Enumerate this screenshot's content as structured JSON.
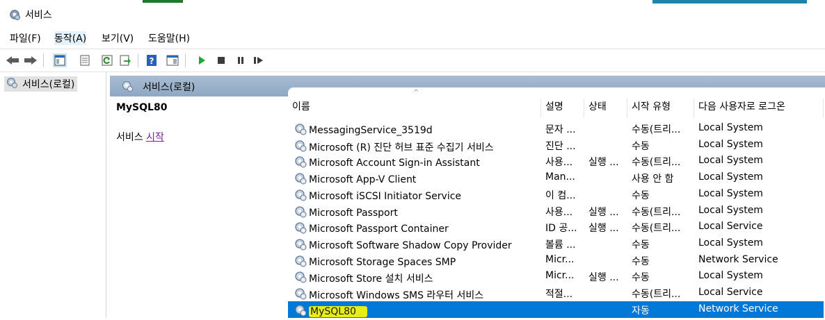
{
  "window": {
    "title": "서비스"
  },
  "menu": [
    "파일(F)",
    "동작(A)",
    "보기(V)",
    "도움말(H)"
  ],
  "toolbar_icons": [
    "back-icon",
    "forward-icon",
    "console-tree-icon",
    "properties-icon",
    "refresh-icon",
    "export-icon",
    "help-icon",
    "show-action-pane-icon",
    "start-service-icon",
    "stop-service-icon",
    "pause-service-icon",
    "resume-service-icon"
  ],
  "tree": {
    "root": "서비스(로컬)"
  },
  "header": {
    "title": "서비스(로컬)"
  },
  "detail": {
    "service_name": "MySQL80",
    "action_prefix": "서비스",
    "action_link": "시작"
  },
  "columns": [
    "이름",
    "설명",
    "상태",
    "시작 유형",
    "다음 사용자로 로그온"
  ],
  "rows": [
    {
      "name": "MessagingService_3519d",
      "desc": "문자 ...",
      "status": "",
      "startup": "수동(트리...",
      "logon": "Local System"
    },
    {
      "name": "Microsoft (R) 진단 허브 표준 수집기 서비스",
      "desc": "진단 ...",
      "status": "",
      "startup": "수동",
      "logon": "Local System"
    },
    {
      "name": "Microsoft Account Sign-in Assistant",
      "desc": "사용...",
      "status": "실행 ...",
      "startup": "수동(트리...",
      "logon": "Local System"
    },
    {
      "name": "Microsoft App-V Client",
      "desc": "Man...",
      "status": "",
      "startup": "사용 안 함",
      "logon": "Local System"
    },
    {
      "name": "Microsoft iSCSI Initiator Service",
      "desc": "이 컴...",
      "status": "",
      "startup": "수동",
      "logon": "Local System"
    },
    {
      "name": "Microsoft Passport",
      "desc": "사용...",
      "status": "실행 ...",
      "startup": "수동(트리...",
      "logon": "Local System"
    },
    {
      "name": "Microsoft Passport Container",
      "desc": "ID 공...",
      "status": "실행 ...",
      "startup": "수동(트리...",
      "logon": "Local Service"
    },
    {
      "name": "Microsoft Software Shadow Copy Provider",
      "desc": "볼륨 ...",
      "status": "",
      "startup": "수동",
      "logon": "Local System"
    },
    {
      "name": "Microsoft Storage Spaces SMP",
      "desc": "Micr...",
      "status": "",
      "startup": "수동",
      "logon": "Network Service"
    },
    {
      "name": "Microsoft Store 설치 서비스",
      "desc": "Micr...",
      "status": "실행 ...",
      "startup": "수동",
      "logon": "Local System"
    },
    {
      "name": "Microsoft Windows SMS 라우터 서비스",
      "desc": "적절...",
      "status": "",
      "startup": "수동(트리...",
      "logon": "Local Service"
    },
    {
      "name": "MySQL80",
      "desc": "",
      "status": "",
      "startup": "자동",
      "logon": "Network Service",
      "selected": true
    }
  ]
}
